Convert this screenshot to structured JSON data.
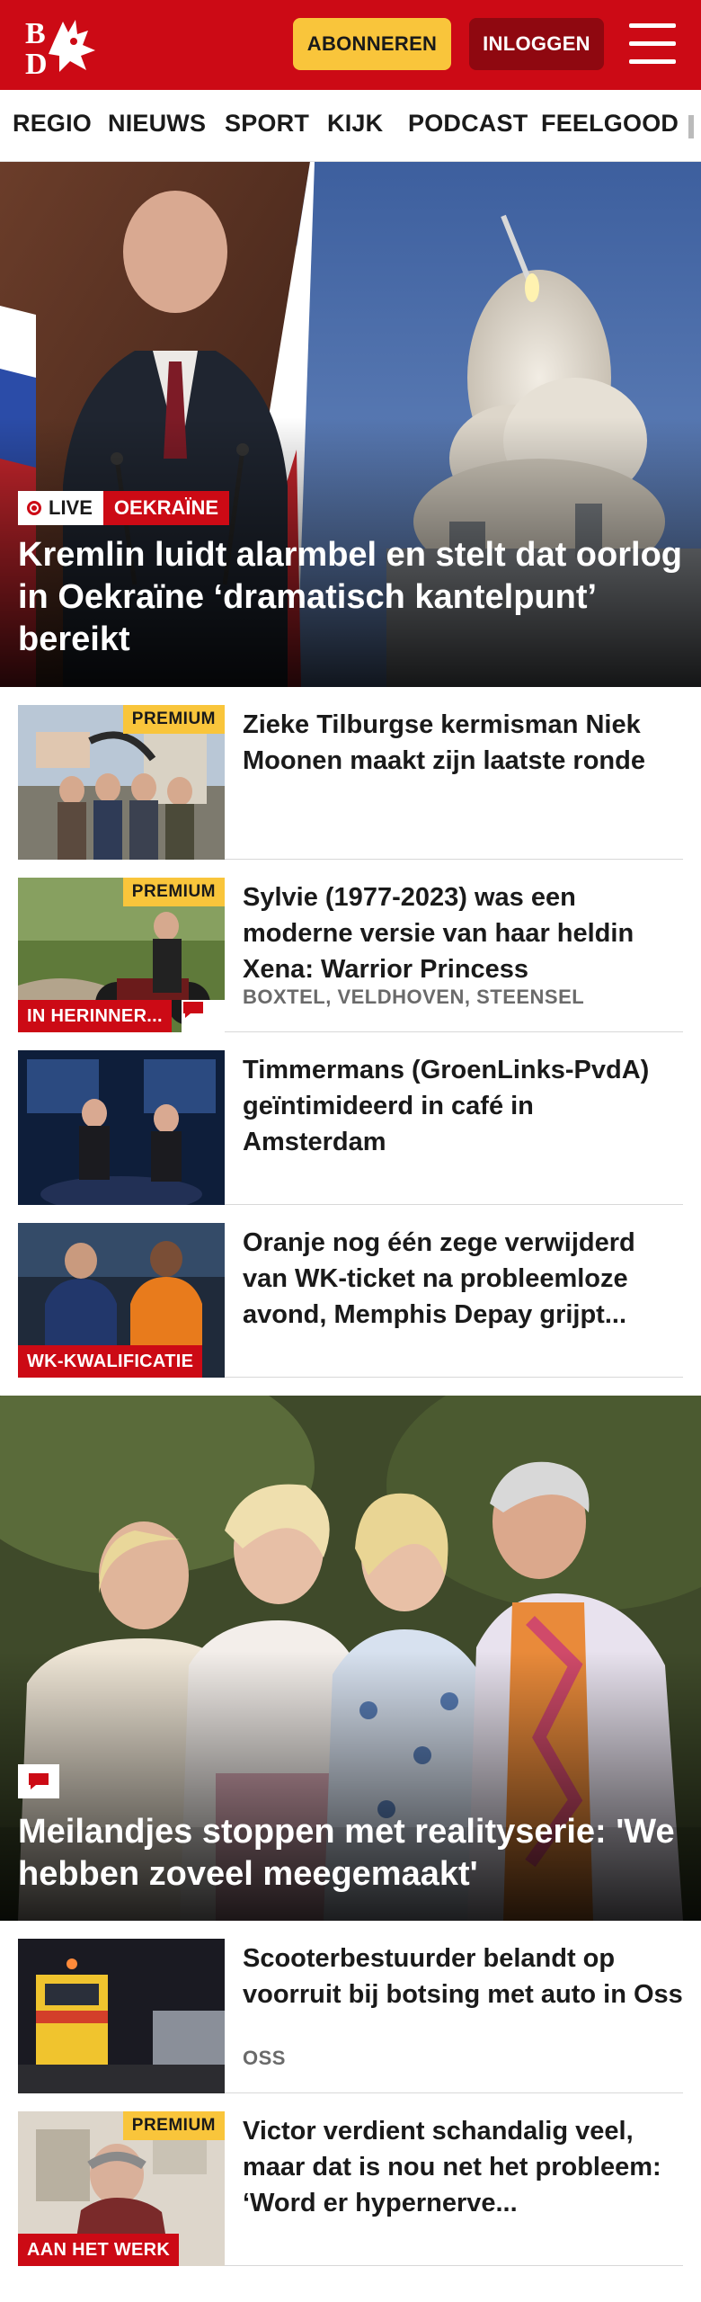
{
  "header": {
    "logo_text": "BD",
    "subscribe_label": "ABONNEREN",
    "login_label": "INLOGGEN",
    "brand_color": "#cc0a15",
    "accent_color": "#f9c53b"
  },
  "nav": {
    "items": [
      "REGIO",
      "NIEUWS",
      "SPORT",
      "KIJK",
      "PODCAST",
      "FEELGOOD"
    ]
  },
  "hero": {
    "live_label": "LIVE",
    "topic_label": "OEKRAÏNE",
    "title": "Kremlin luidt alarmbel en stelt dat oorlog in Oekraïne ‘dramatisch kantelpunt’ bereikt"
  },
  "articles": [
    {
      "title": "Zieke Tilburgse kermisman Niek Moonen maakt zijn laatste ronde",
      "premium_label": "PREMIUM"
    },
    {
      "title": "Sylvie (1977-2023) was een moderne versie van haar heldin Xena: Warrior Princess",
      "premium_label": "PREMIUM",
      "tag": "IN HERINNER...",
      "meta": "BOXTEL, VELDHOVEN, STEENSEL"
    },
    {
      "title": "Timmermans (GroenLinks-PvdA) geïntimideerd in café in Amsterdam"
    },
    {
      "title": "Oranje nog één zege verwijderd van WK-ticket na probleemloze avond, Memphis Depay grijpt...",
      "tag": "WK-KWALIFICATIE"
    }
  ],
  "feature": {
    "title": "Meilandjes stoppen met realityserie: 'We hebben zoveel meegemaakt'"
  },
  "articles2": [
    {
      "title": "Scooterbestuurder belandt op voorruit bij botsing met auto in Oss",
      "meta": "OSS"
    },
    {
      "title": "Victor verdient schandalig veel, maar dat is nou net het probleem: ‘Word er hypernerve...",
      "premium_label": "PREMIUM",
      "tag": "AAN HET WERK"
    }
  ]
}
